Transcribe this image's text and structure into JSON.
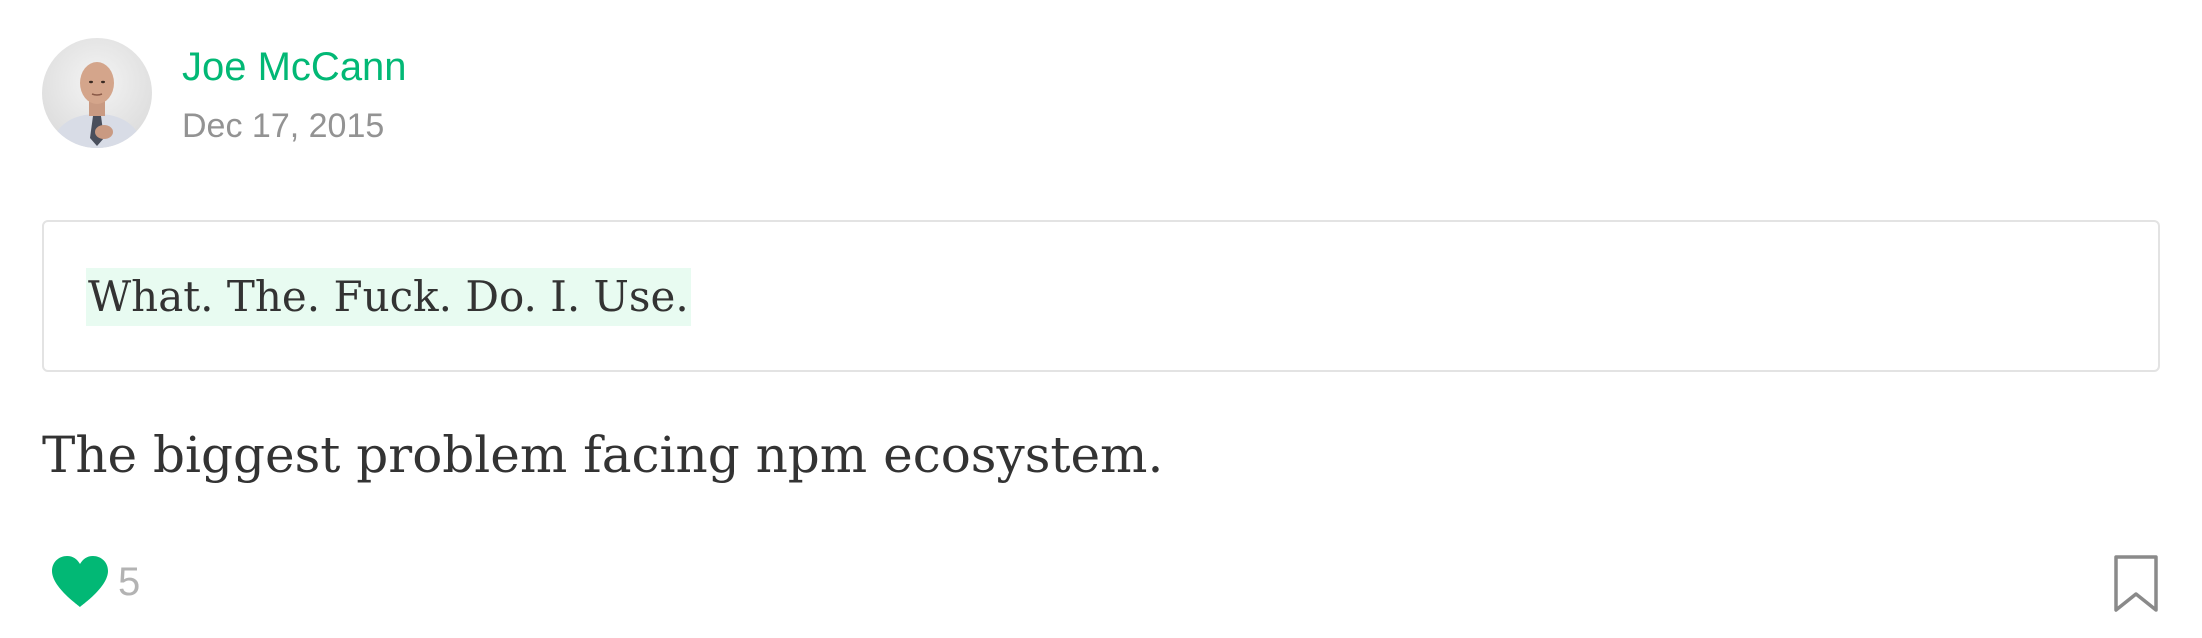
{
  "post": {
    "author": {
      "name": "Joe McCann",
      "avatar_icon": "person-avatar"
    },
    "date": "Dec 17, 2015",
    "quote": "What. The. Fuck. Do. I. Use.",
    "subtitle": "The biggest problem facing npm ecosystem.",
    "likes": "5"
  },
  "colors": {
    "accent": "#02b875",
    "muted": "#939393",
    "highlight": "#e8fbf1",
    "text": "#333333",
    "border": "#e3e3e3"
  }
}
